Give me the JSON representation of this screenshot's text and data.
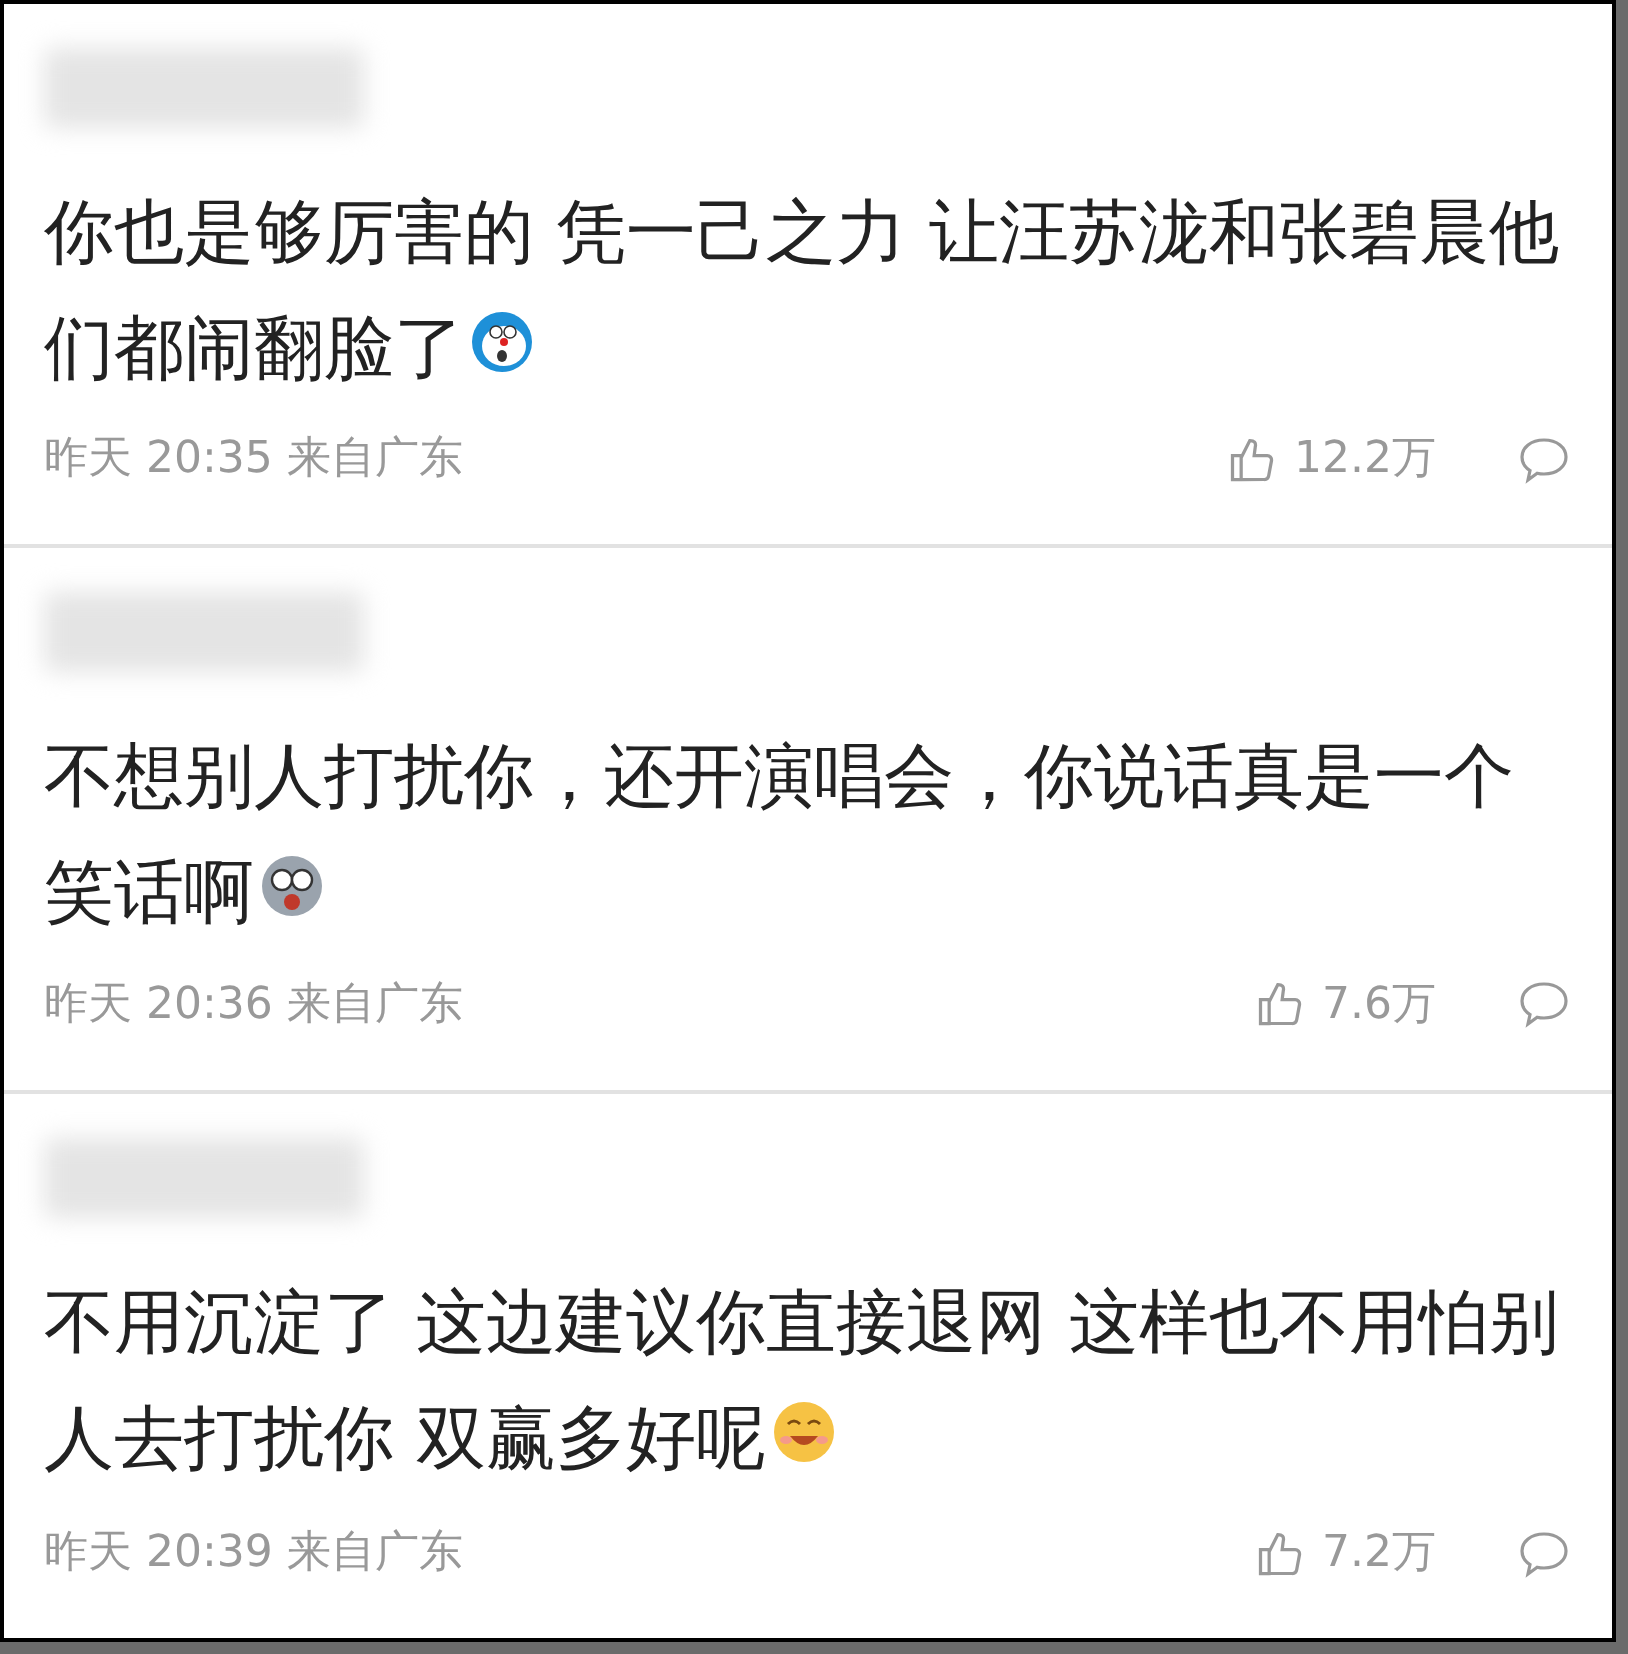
{
  "comments": [
    {
      "text": "你也是够厉害的 凭一己之力 让汪苏泷和张碧晨他们都闹翻脸了",
      "kind": "cartoon",
      "time": "昨天 20:35 来自广东",
      "likes": "12.2万"
    },
    {
      "text": "不想别人打扰你，还开演唱会，你说话真是一个笑话啊",
      "kind": "dizzy",
      "time": "昨天 20:36 来自广东",
      "likes": "7.6万"
    },
    {
      "text": "不用沉淀了 这边建议你直接退网 这样也不用怕别人去打扰你 双赢多好呢",
      "kind": "smile",
      "time": "昨天 20:39 来自广东",
      "likes": "7.2万"
    }
  ]
}
